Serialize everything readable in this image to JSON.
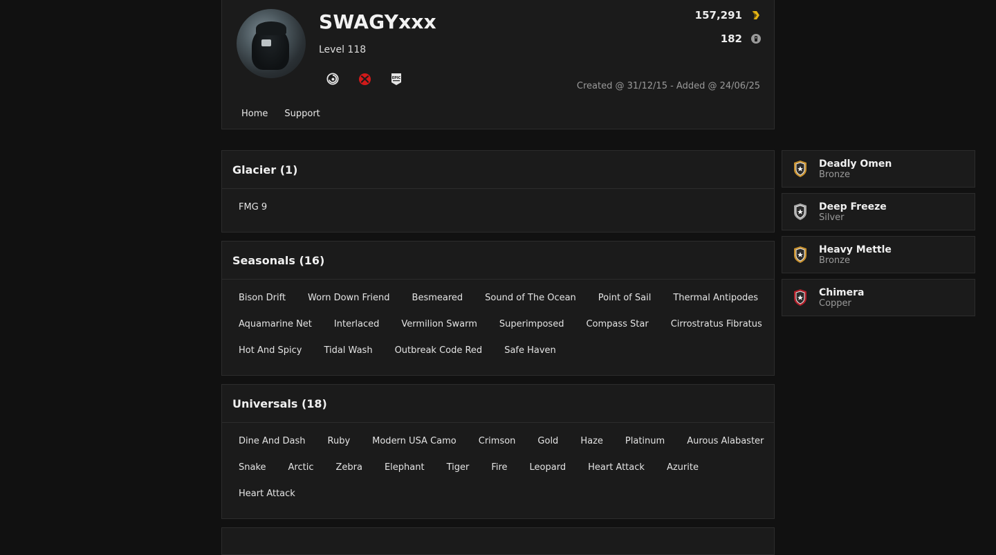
{
  "profile": {
    "username": "SWAGYxxx",
    "level": "Level 118",
    "renown": "157,291",
    "credits": "182",
    "created": "Created @ 31/12/15 - Added @ 24/06/25",
    "platforms": [
      "ubisoft-icon",
      "xbox-icon",
      "epic-games-icon"
    ]
  },
  "nav": {
    "home": "Home",
    "support": "Support"
  },
  "sections": [
    {
      "title": "Glacier (1)",
      "items": [
        "FMG 9"
      ]
    },
    {
      "title": "Seasonals (16)",
      "items": [
        "Bison Drift",
        "Worn Down Friend",
        "Besmeared",
        "Sound of The Ocean",
        "Point of Sail",
        "Thermal Antipodes",
        "Aquamarine Net",
        "Interlaced",
        "Vermilion Swarm",
        "Superimposed",
        "Compass Star",
        "Cirrostratus Fibratus",
        "Hot And Spicy",
        "Tidal Wash",
        "Outbreak Code Red",
        "Safe Haven"
      ]
    },
    {
      "title": "Universals (18)",
      "items": [
        "Dine And Dash",
        "Ruby",
        "Modern USA Camo",
        "Crimson",
        "Gold",
        "Haze",
        "Platinum",
        "Aurous Alabaster",
        "Snake",
        "Arctic",
        "Zebra",
        "Elephant",
        "Tiger",
        "Fire",
        "Leopard",
        "Heart Attack",
        "Azurite",
        "Heart Attack"
      ]
    }
  ],
  "achievements": [
    {
      "name": "Deadly Omen",
      "tier": "Bronze",
      "color": "#c8912e"
    },
    {
      "name": "Deep Freeze",
      "tier": "Silver",
      "color": "#a9a9a9"
    },
    {
      "name": "Heavy Mettle",
      "tier": "Bronze",
      "color": "#c8912e"
    },
    {
      "name": "Chimera",
      "tier": "Copper",
      "color": "#b3202a"
    }
  ],
  "colors": {
    "background": "#111111",
    "panel": "#1b1b1b",
    "border": "#2c2c2c",
    "renown_icon": "#e3b314",
    "xbox": "#d11a1a"
  }
}
